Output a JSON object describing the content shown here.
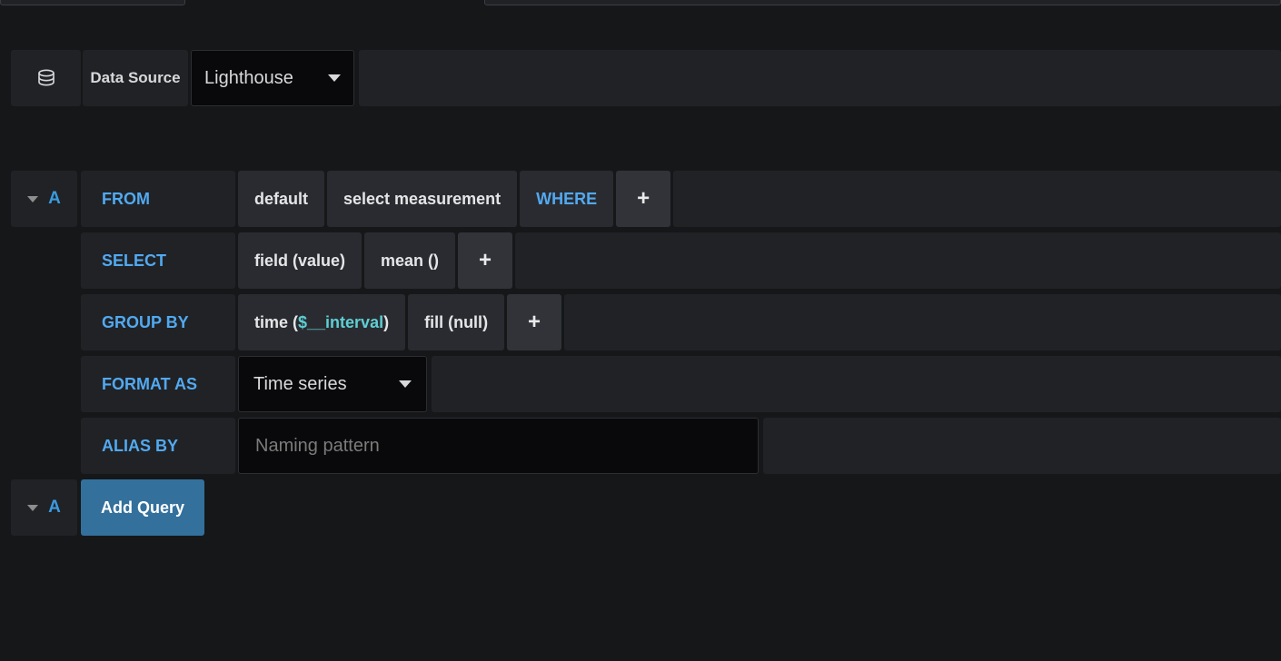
{
  "top_cut_elements": [
    {
      "name": "panel-edge-left"
    },
    {
      "name": "panel-edge-right"
    }
  ],
  "datasource_row": {
    "icon": "database-icon",
    "label": "Data Source",
    "selected": "Lighthouse",
    "caret": "chevron-down-icon"
  },
  "query": {
    "ref_id": "A",
    "collapse_icon": "caret-down-icon",
    "rows": {
      "from": {
        "label": "FROM",
        "policy": "default",
        "measurement": "select measurement",
        "where": "WHERE",
        "add": "+"
      },
      "select": {
        "label": "SELECT",
        "field": "field (value)",
        "func": "mean ()",
        "add": "+"
      },
      "group_by": {
        "label": "GROUP BY",
        "time_prefix": "time (",
        "time_var": "$__interval",
        "time_suffix": ")",
        "fill": "fill (null)",
        "add": "+"
      },
      "format_as": {
        "label": "FORMAT AS",
        "selected": "Time series",
        "caret": "chevron-down-icon"
      },
      "alias_by": {
        "label": "ALIAS BY",
        "value": "",
        "placeholder": "Naming pattern"
      }
    }
  },
  "footer": {
    "ref_id": "A",
    "collapse_icon": "caret-down-icon",
    "add_query_label": "Add Query"
  },
  "colors": {
    "page_background": "#161719",
    "panel": "#202226",
    "segment": "#2a2b30",
    "segment_plus": "#313338",
    "accent_blue": "#52a9f0",
    "ref_blue": "#3b9ae0",
    "variable_cyan": "#5ecfd4",
    "button_blue": "#33709c",
    "input_background": "#09090b",
    "text_primary": "#e4e5e6",
    "placeholder": "#7b7b7b"
  }
}
